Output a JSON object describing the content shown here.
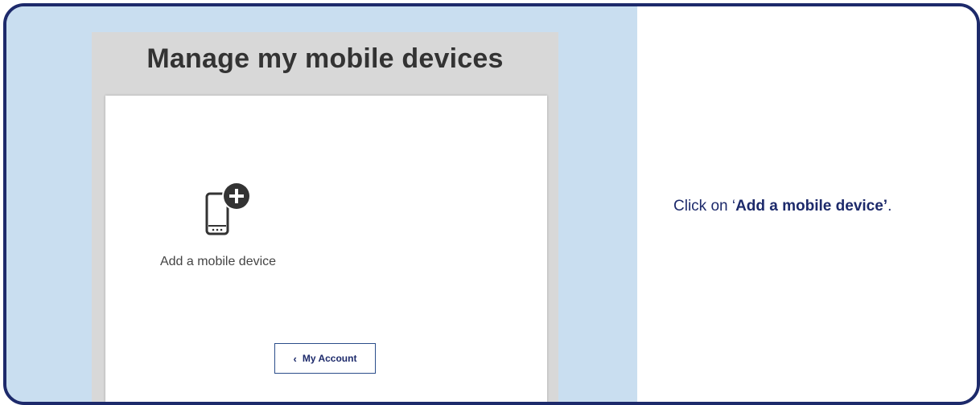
{
  "screenshot": {
    "page_title": "Manage my mobile devices",
    "add_device": {
      "icon": "mobile-add-icon",
      "label": "Add a mobile device"
    },
    "account_button": {
      "chevron": "‹",
      "label": "My Account"
    }
  },
  "instruction": {
    "prefix": "Click on ‘",
    "emphasis": "Add a mobile device’",
    "suffix": "."
  },
  "colors": {
    "frame_border": "#1d2a6b",
    "left_panel_bg": "#c9def0",
    "text_accent": "#1d2a6b"
  }
}
